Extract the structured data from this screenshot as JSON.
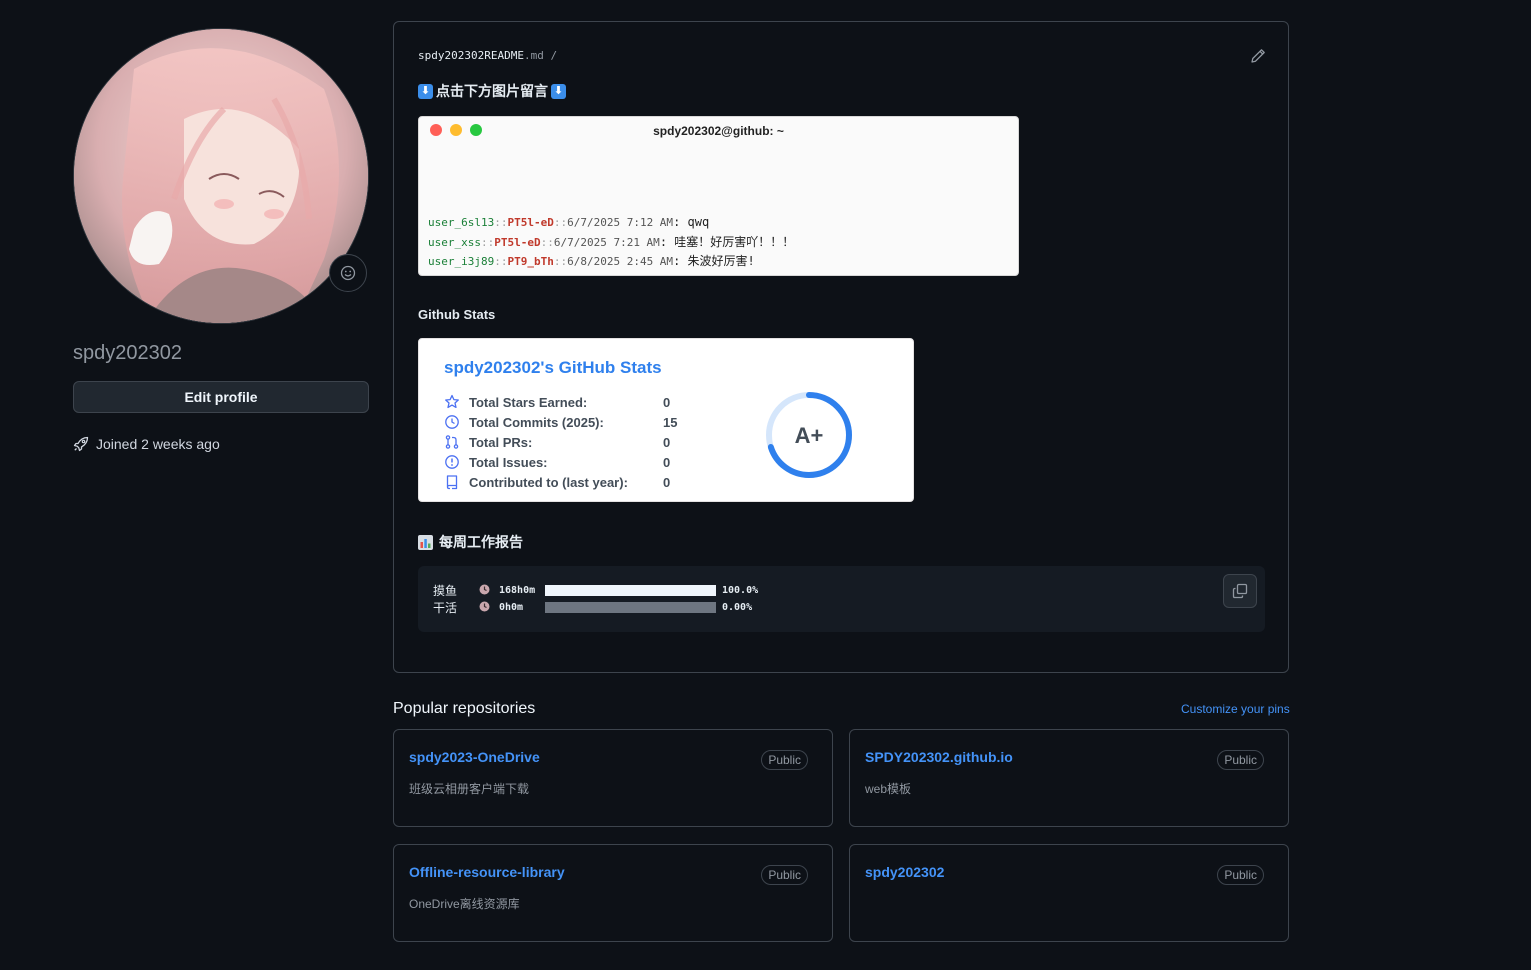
{
  "profile": {
    "username": "spdy202302",
    "edit_profile_label": "Edit profile",
    "joined": "Joined 2 weeks ago"
  },
  "readme": {
    "path_name": "spdy202302README",
    "path_ext": ".md",
    "path_sep": "/",
    "leave_message_heading": "点击下方图片留言",
    "terminal": {
      "title": "spdy202302@github: ~",
      "dots": [
        "#ff5f57",
        "#febc2e",
        "#28c840"
      ],
      "lines": [
        {
          "user": "user_6sl13",
          "tag": "PT5l-eD",
          "date": "6/7/2025 7:12 AM",
          "msg": "qwq"
        },
        {
          "user": "user_xss",
          "tag": "PT5l-eD",
          "date": "6/7/2025 7:21 AM",
          "msg": "哇塞！好厉害吖！！！"
        },
        {
          "user": "user_i3j89",
          "tag": "PT9_bTh",
          "date": "6/8/2025 2:45 AM",
          "msg": "朱波好厉害!"
        }
      ]
    },
    "stats_heading": "Github Stats",
    "stats_card": {
      "title": "spdy202302's GitHub Stats",
      "rows": [
        {
          "icon": "star-icon",
          "label": "Total Stars Earned:",
          "value": "0"
        },
        {
          "icon": "history-icon",
          "label": "Total Commits (2025):",
          "value": "15"
        },
        {
          "icon": "pull-request-icon",
          "label": "Total PRs:",
          "value": "0"
        },
        {
          "icon": "issue-icon",
          "label": "Total Issues:",
          "value": "0"
        },
        {
          "icon": "repo-icon",
          "label": "Contributed to (last year):",
          "value": "0"
        }
      ],
      "rank": "A+",
      "rank_progress": 0.7,
      "accent": "#2f80ed"
    },
    "weekly_heading": "每周工作报告",
    "weekly_report": [
      {
        "label": "摸鱼",
        "duration": "168h0m",
        "percent": "100.0%",
        "fraction": 1.0
      },
      {
        "label": "干活",
        "duration": "0h0m",
        "percent": "0.00%",
        "fraction": 0.0
      }
    ]
  },
  "popular": {
    "title": "Popular repositories",
    "customize_label": "Customize your pins",
    "repos": [
      {
        "name": "spdy2023-OneDrive",
        "visibility": "Public",
        "description": "班级云相册客户端下载"
      },
      {
        "name": "SPDY202302.github.io",
        "visibility": "Public",
        "description": "web模板"
      },
      {
        "name": "Offline-resource-library",
        "visibility": "Public",
        "description": "OneDrive离线资源库"
      },
      {
        "name": "spdy202302",
        "visibility": "Public",
        "description": ""
      }
    ]
  },
  "colors": {
    "background": "#0d1117",
    "link": "#4493f8",
    "border": "#3d444d"
  }
}
